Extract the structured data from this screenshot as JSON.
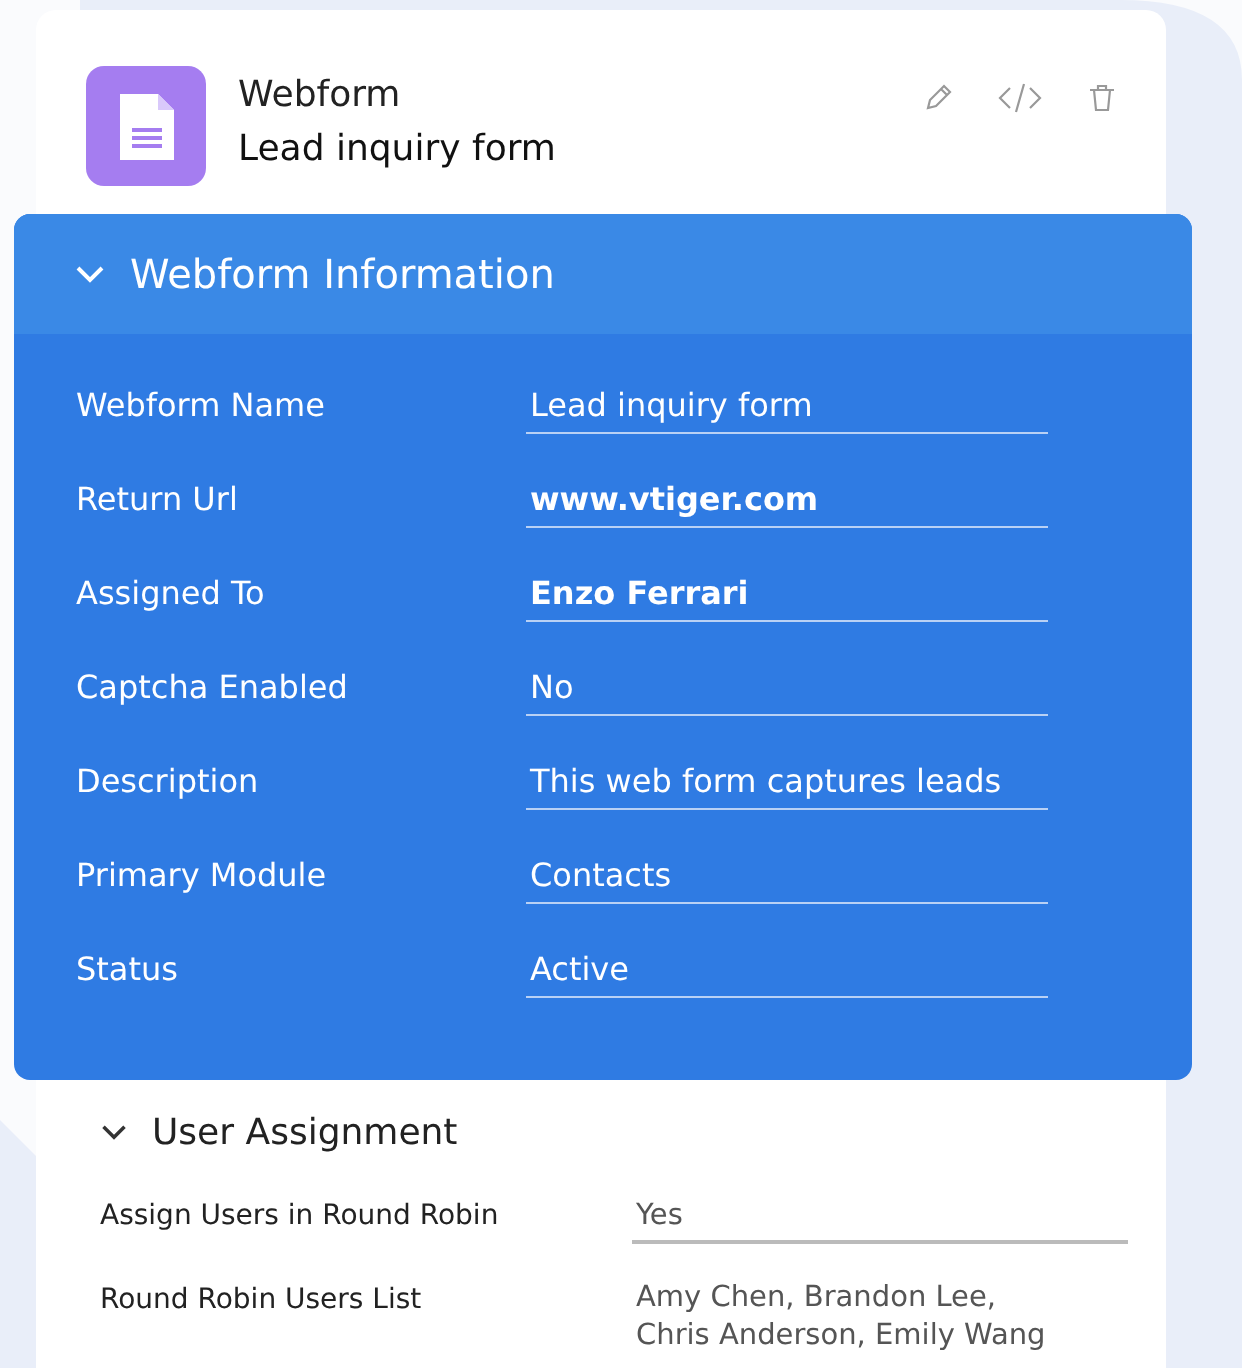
{
  "record": {
    "module": "Webform",
    "name": "Lead inquiry form"
  },
  "sections": [
    {
      "title": "Webform Information",
      "kind": "panel",
      "expanded": true,
      "fields": [
        {
          "label": "Webform Name",
          "value": "Lead inquiry form",
          "emphasis": false
        },
        {
          "label": "Return Url",
          "value": "www.vtiger.com",
          "emphasis": true
        },
        {
          "label": "Assigned To",
          "value": "Enzo Ferrari",
          "emphasis": true
        },
        {
          "label": "Captcha Enabled",
          "value": "No",
          "emphasis": false
        },
        {
          "label": "Description",
          "value": "This web form captures leads",
          "emphasis": false
        },
        {
          "label": "Primary Module",
          "value": "Contacts",
          "emphasis": false
        },
        {
          "label": "Status",
          "value": "Active",
          "emphasis": false
        }
      ]
    },
    {
      "title": "User Assignment",
      "kind": "plain",
      "expanded": true,
      "fields": [
        {
          "label": "Assign Users in Round Robin",
          "value": "Yes",
          "emphasis": false
        },
        {
          "label": "Round Robin Users List",
          "value_lines": [
            "Amy Chen, Brandon Lee,",
            "Chris Anderson, Emily Wang"
          ],
          "emphasis": false
        }
      ]
    }
  ]
}
